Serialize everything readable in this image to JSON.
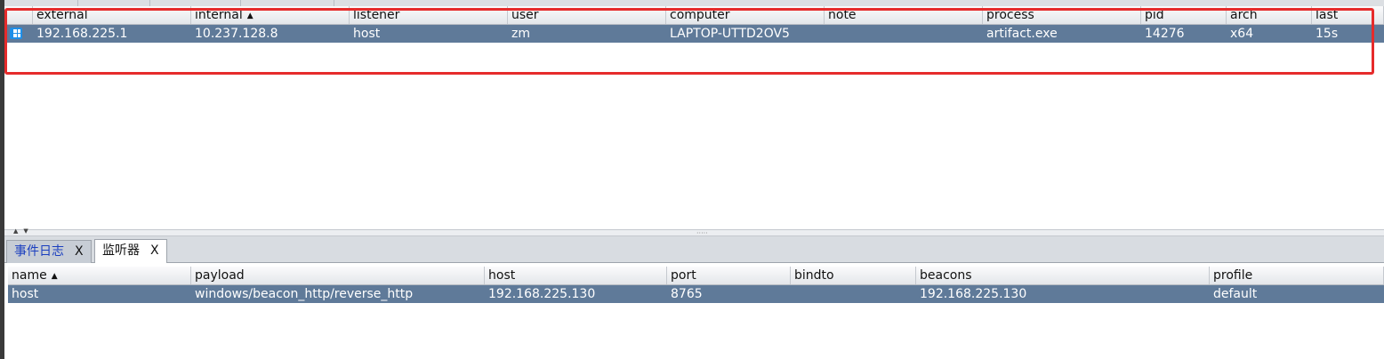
{
  "beacons": {
    "columns": [
      {
        "label": "external",
        "sort": ""
      },
      {
        "label": "internal",
        "sort": "▲"
      },
      {
        "label": "listener",
        "sort": ""
      },
      {
        "label": "user",
        "sort": ""
      },
      {
        "label": "computer",
        "sort": ""
      },
      {
        "label": "note",
        "sort": ""
      },
      {
        "label": "process",
        "sort": ""
      },
      {
        "label": "pid",
        "sort": ""
      },
      {
        "label": "arch",
        "sort": ""
      },
      {
        "label": "last",
        "sort": ""
      }
    ],
    "rows": [
      {
        "os_icon": "windows-icon",
        "external": "192.168.225.1",
        "internal": "10.237.128.8",
        "listener": "host",
        "user": "zm",
        "computer": "LAPTOP-UTTD2OV5",
        "note": "",
        "process": "artifact.exe",
        "pid": "14276",
        "arch": "x64",
        "last": "15s"
      }
    ]
  },
  "tabs": [
    {
      "label": "事件日志",
      "close": "X",
      "active": false
    },
    {
      "label": "监听器",
      "close": "X",
      "active": true
    }
  ],
  "listeners": {
    "columns": [
      {
        "label": "name",
        "sort": "▲"
      },
      {
        "label": "payload",
        "sort": ""
      },
      {
        "label": "host",
        "sort": ""
      },
      {
        "label": "port",
        "sort": ""
      },
      {
        "label": "bindto",
        "sort": ""
      },
      {
        "label": "beacons",
        "sort": ""
      },
      {
        "label": "profile",
        "sort": ""
      }
    ],
    "rows": [
      {
        "name": "host",
        "payload": "windows/beacon_http/reverse_http",
        "host": "192.168.225.130",
        "port": "8765",
        "bindto": "",
        "beacons": "192.168.225.130",
        "profile": "default"
      }
    ]
  },
  "colors": {
    "selection": "#5f7a99",
    "highlight_border": "#e62b2b",
    "tab_inactive_text": "#1b3fbf"
  }
}
